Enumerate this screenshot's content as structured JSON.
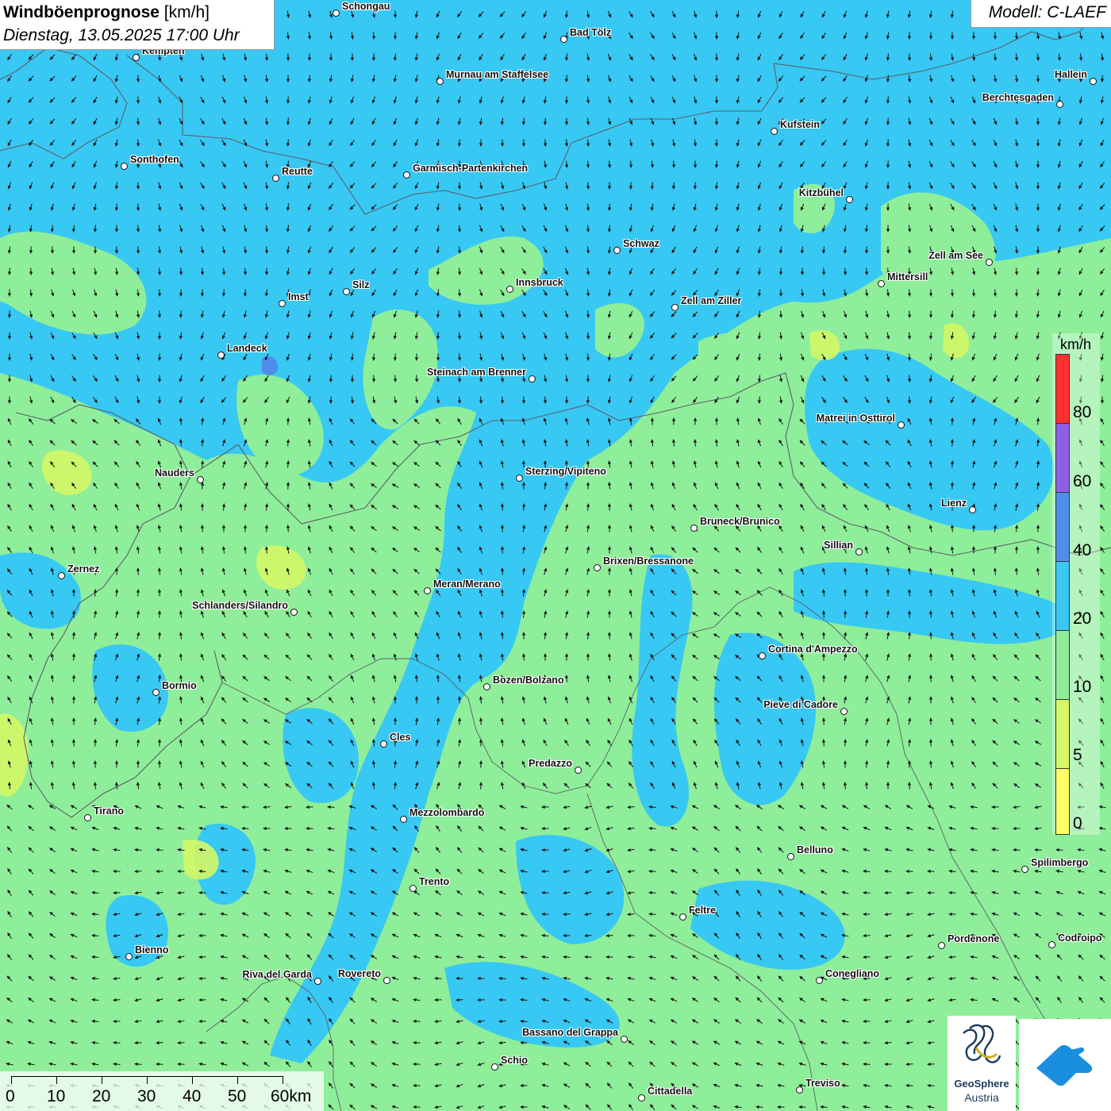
{
  "header": {
    "title_bold": "Windböenprognose",
    "title_unit": " [km/h]",
    "subtitle": "Dienstag, 13.05.2025 17:00 Uhr",
    "model": "Modell: C-LAEF"
  },
  "legend": {
    "unit": "km/h",
    "labels": [
      "80",
      "60",
      "40",
      "20",
      "10",
      "5",
      "0"
    ],
    "colors": {
      "c_0_5": "#ffff66",
      "c_5_10": "#d4f766",
      "c_10_20": "#8fee9a",
      "c_20_40": "#38c8f4",
      "c_40_60": "#4f8ee8",
      "c_60_80": "#8f5ee6",
      "c_80_plus": "#ff3030"
    }
  },
  "scalebar": {
    "labels": [
      "0",
      "10",
      "20",
      "30",
      "40",
      "50",
      "60km"
    ]
  },
  "logos": {
    "geosphere_line1": "GeoSphere",
    "geosphere_line2": "Austria",
    "app_icon": "wind-app-icon"
  },
  "cities": [
    {
      "name": "Schongau"
    },
    {
      "name": "Bad Tölz"
    },
    {
      "name": "Kempten"
    },
    {
      "name": "Murnau am Staffelsee"
    },
    {
      "name": "Hallein"
    },
    {
      "name": "Berchtesgaden"
    },
    {
      "name": "Kufstein"
    },
    {
      "name": "Sonthofen"
    },
    {
      "name": "Reutte"
    },
    {
      "name": "Garmisch-Partenkirchen"
    },
    {
      "name": "Kitzbühel"
    },
    {
      "name": "Schwaz"
    },
    {
      "name": "Zell am See"
    },
    {
      "name": "Innsbruck"
    },
    {
      "name": "Mittersill"
    },
    {
      "name": "Silz"
    },
    {
      "name": "Imst"
    },
    {
      "name": "Zell am Ziller"
    },
    {
      "name": "Landeck"
    },
    {
      "name": "Steinach am Brenner"
    },
    {
      "name": "Matrei in Osttirol"
    },
    {
      "name": "Nauders"
    },
    {
      "name": "Sterzing/Vipiteno"
    },
    {
      "name": "Lienz"
    },
    {
      "name": "Bruneck/Brunico"
    },
    {
      "name": "Sillian"
    },
    {
      "name": "Brixen/Bressanone"
    },
    {
      "name": "Zernez"
    },
    {
      "name": "Meran/Merano"
    },
    {
      "name": "Schlanders/Silandro"
    },
    {
      "name": "Cortina d'Ampezzo"
    },
    {
      "name": "Bozen/Bolzano"
    },
    {
      "name": "Bormio"
    },
    {
      "name": "Pieve di Cadore"
    },
    {
      "name": "Cles"
    },
    {
      "name": "Predazzo"
    },
    {
      "name": "Tirano"
    },
    {
      "name": "Mezzolombardo"
    },
    {
      "name": "Belluno"
    },
    {
      "name": "Spilimbergo"
    },
    {
      "name": "Trento"
    },
    {
      "name": "Feltre"
    },
    {
      "name": "Pordenone"
    },
    {
      "name": "Codroipo"
    },
    {
      "name": "Bienno"
    },
    {
      "name": "Riva del Garda"
    },
    {
      "name": "Rovereto"
    },
    {
      "name": "Conegliano"
    },
    {
      "name": "Bassano del Grappa"
    },
    {
      "name": "Schio"
    },
    {
      "name": "Treviso"
    },
    {
      "name": "Cittadella"
    }
  ]
}
